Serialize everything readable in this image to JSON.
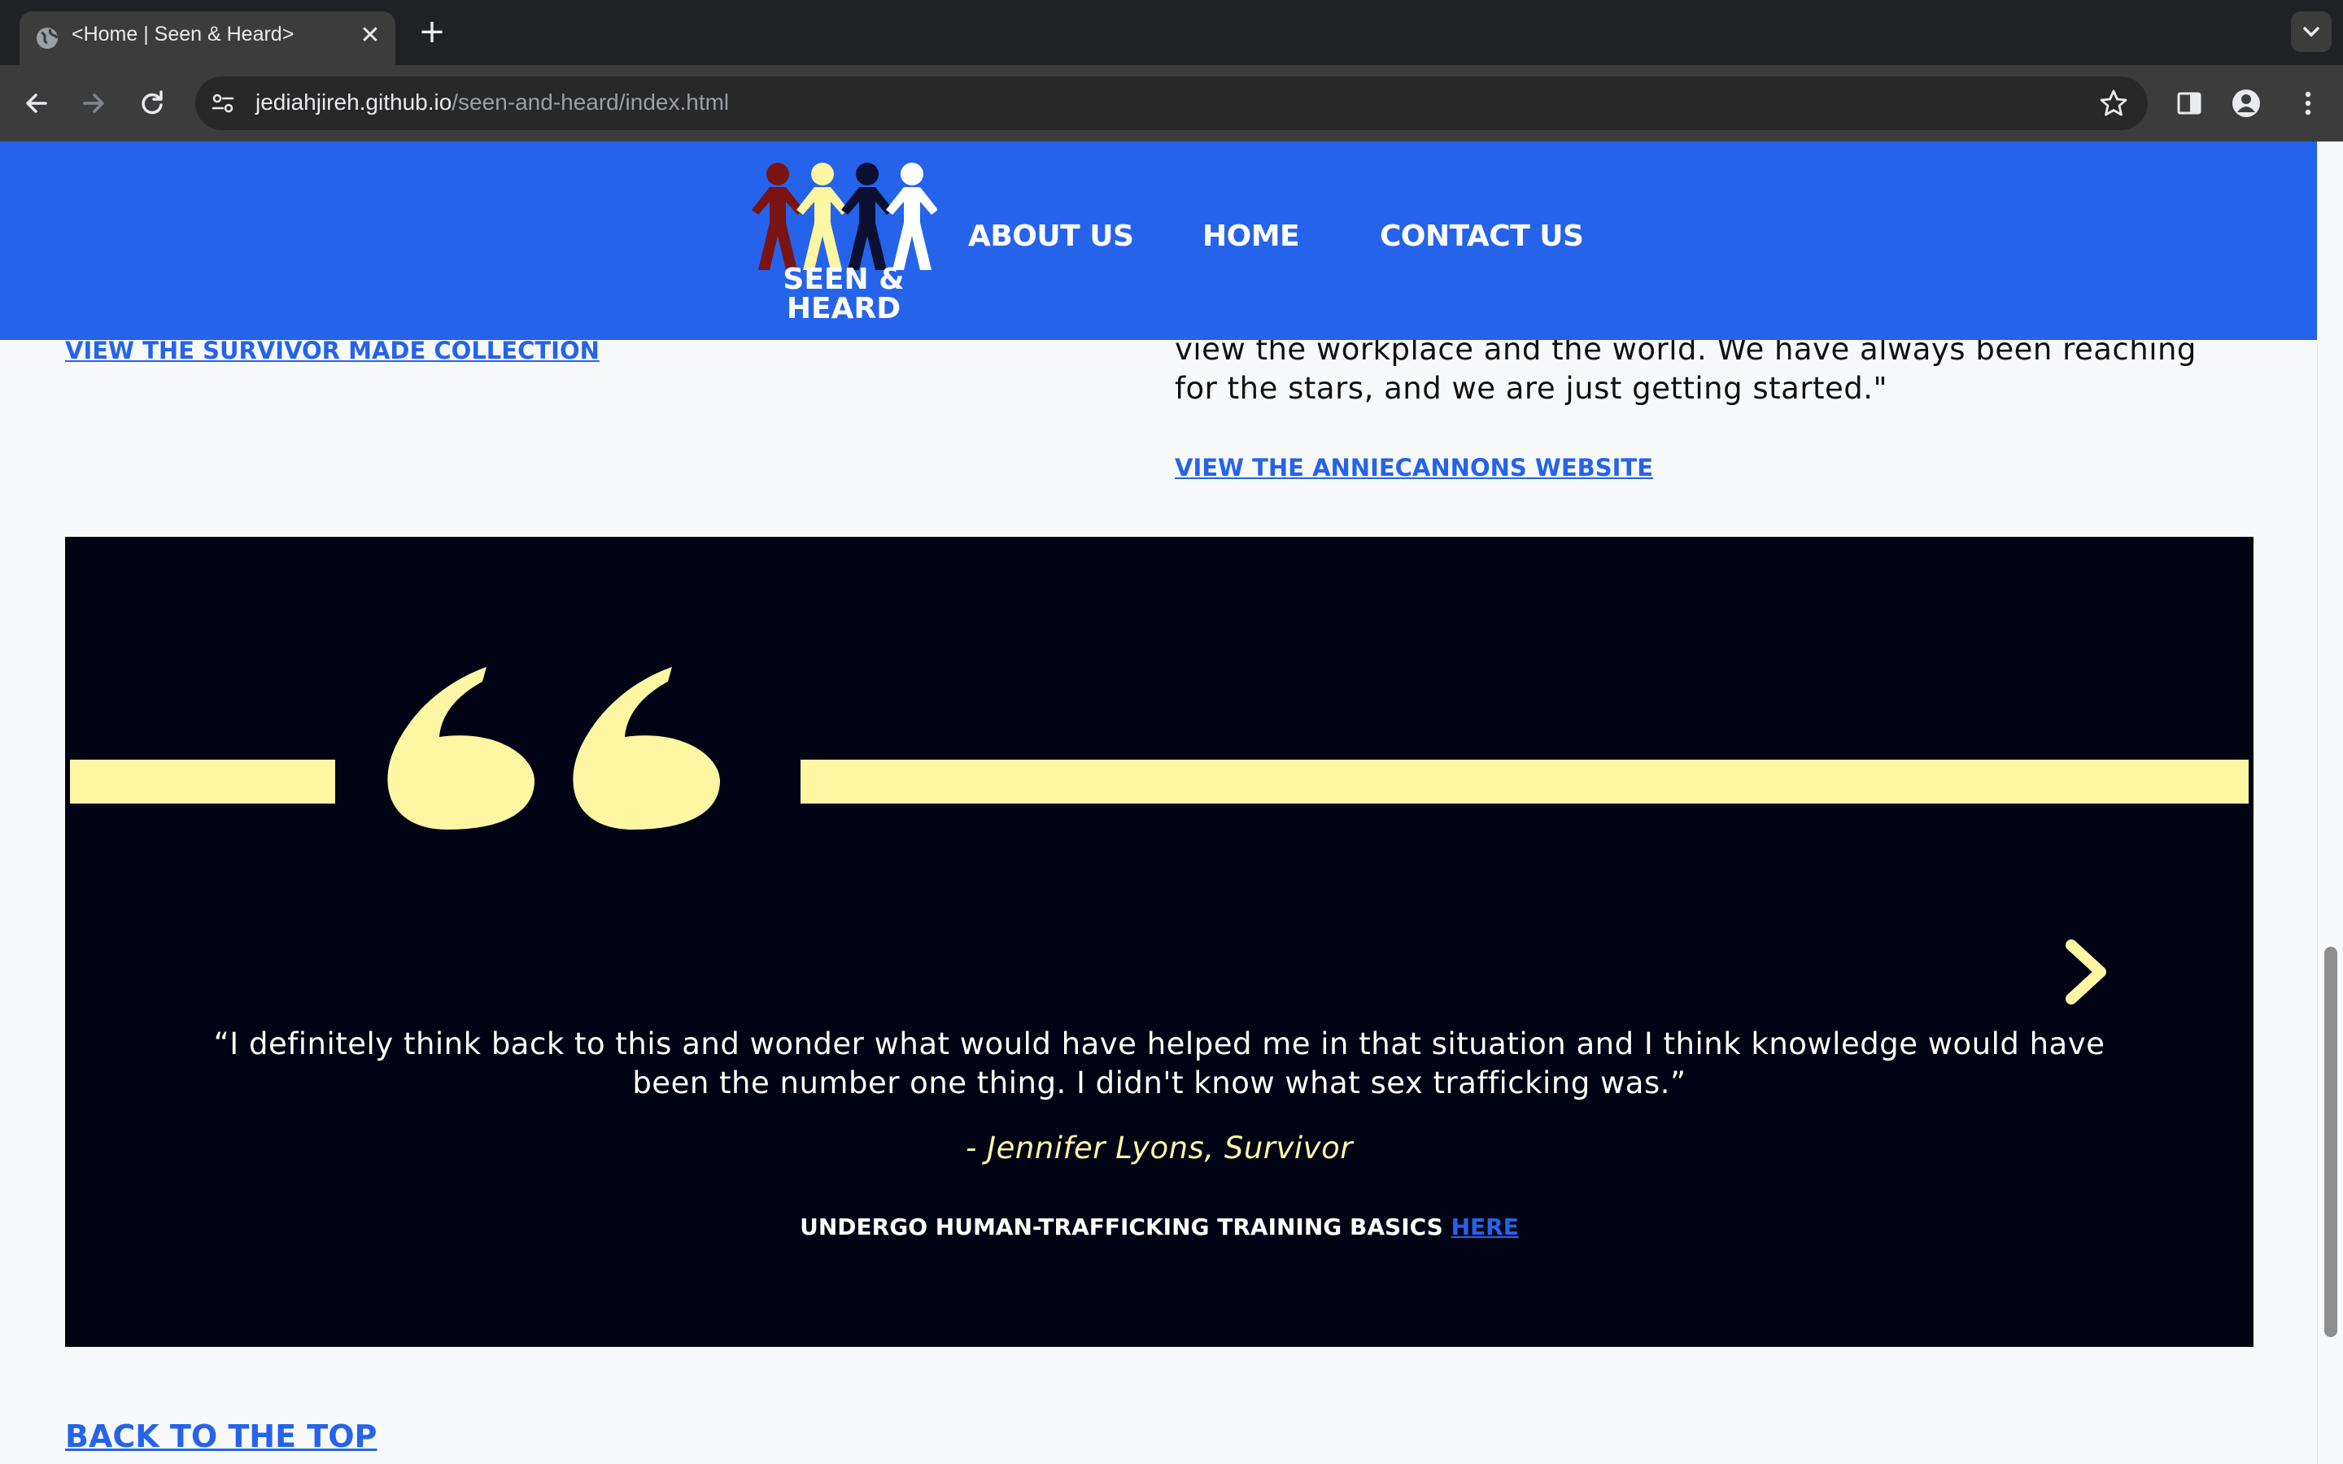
{
  "browser": {
    "tab_title": "<Home | Seen & Heard>",
    "url_host": "jediahjireh.github.io",
    "url_path": "/seen-and-heard/index.html",
    "icons": [
      "globe-icon",
      "close-icon",
      "plus-icon",
      "chevron-down-icon",
      "back-arrow-icon",
      "forward-arrow-icon",
      "reload-icon",
      "site-info-icon",
      "star-icon",
      "side-panel-icon",
      "profile-icon",
      "kebab-menu-icon"
    ]
  },
  "header": {
    "logo_line1": "SEEN &",
    "logo_line2": "HEARD",
    "nav": [
      "ABOUT US",
      "HOME",
      "CONTACT US"
    ],
    "background": "#2563eb"
  },
  "content": {
    "survivor_link": "VIEW THE SURVIVOR MADE COLLECTION",
    "body_text": "view the workplace and the world. We have always been reaching for the stars, and we are just getting started.\"",
    "anniecannons_link": "VIEW THE ANNIECANNONS WEBSITE",
    "back_to_top": "BACK TO THE TOP"
  },
  "testimonial": {
    "quote": "“I definitely think back to this and wonder what would have helped me in that situation and I think knowledge would have been the number one thing. I didn't know what sex trafficking was.”",
    "author": "- Jennifer Lyons, Survivor",
    "training_text": "UNDERGO HUMAN-TRAFFICKING TRAINING BASICS ",
    "training_link": "HERE",
    "accent": "#fdf6a3",
    "background": "#000314"
  }
}
